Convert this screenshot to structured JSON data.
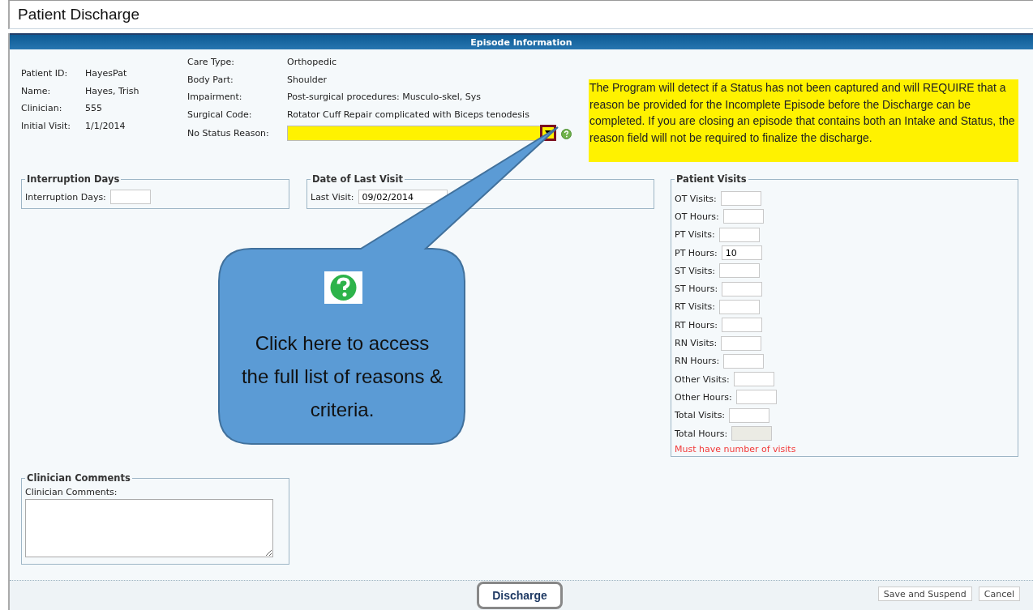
{
  "title": "Patient Discharge",
  "section_header": "Episode Information",
  "patient_info": [
    {
      "label": "Patient ID:",
      "value": "HayesPat"
    },
    {
      "label": "Name:",
      "value": "Hayes, Trish"
    },
    {
      "label": "Clinician:",
      "value": "555"
    },
    {
      "label": "Initial Visit:",
      "value": "1/1/2014"
    }
  ],
  "episode_info": [
    {
      "label": "Care Type:",
      "value": "Orthopedic"
    },
    {
      "label": "Body Part:",
      "value": "Shoulder"
    },
    {
      "label": "Impairment:",
      "value": "Post-surgical procedures: Musculo-skel, Sys"
    },
    {
      "label": "Surgical Code:",
      "value": "Rotator Cuff Repair complicated with Biceps tenodesis"
    }
  ],
  "no_status_reason": {
    "label": "No Status Reason:"
  },
  "note": "The Program will detect if a Status has not been captured  and will REQUIRE that a reason be provided for the Incomplete Episode before the Discharge can be completed. If you are closing an episode that contains both an Intake and Status, the reason field will not be required to finalize the discharge.",
  "interruption": {
    "legend": "Interruption Days",
    "label": "Interruption Days:"
  },
  "last_visit": {
    "legend": "Date of Last Visit",
    "label": "Last Visit:",
    "value": "09/02/2014"
  },
  "patient_visits": {
    "legend": "Patient Visits",
    "fields": [
      {
        "label": "OT Visits:",
        "disabled": false
      },
      {
        "label": "OT Hours:",
        "disabled": false
      },
      {
        "label": "PT Visits:",
        "disabled": false
      },
      {
        "label": "PT Hours:",
        "value": "10",
        "disabled": false
      },
      {
        "label": "ST Visits:",
        "disabled": false
      },
      {
        "label": "ST Hours:",
        "disabled": false
      },
      {
        "label": "RT Visits:",
        "disabled": false
      },
      {
        "label": "RT Hours:",
        "disabled": false
      },
      {
        "label": "RN Visits:",
        "disabled": false
      },
      {
        "label": "RN Hours:",
        "disabled": false
      },
      {
        "label": "Other Visits:",
        "disabled": false
      },
      {
        "label": "Other Hours:",
        "disabled": false
      },
      {
        "label": "Total Visits:",
        "disabled": false
      },
      {
        "label": "Total Hours:",
        "disabled": true
      }
    ],
    "error": "Must have number of visits"
  },
  "comments": {
    "legend": "Clinician Comments",
    "label": "Clinician Comments:"
  },
  "buttons": {
    "discharge": "Discharge",
    "save": "Save and Suspend",
    "cancel": "Cancel"
  },
  "callout": {
    "text": "Click here to access the full list of reasons & criteria."
  }
}
